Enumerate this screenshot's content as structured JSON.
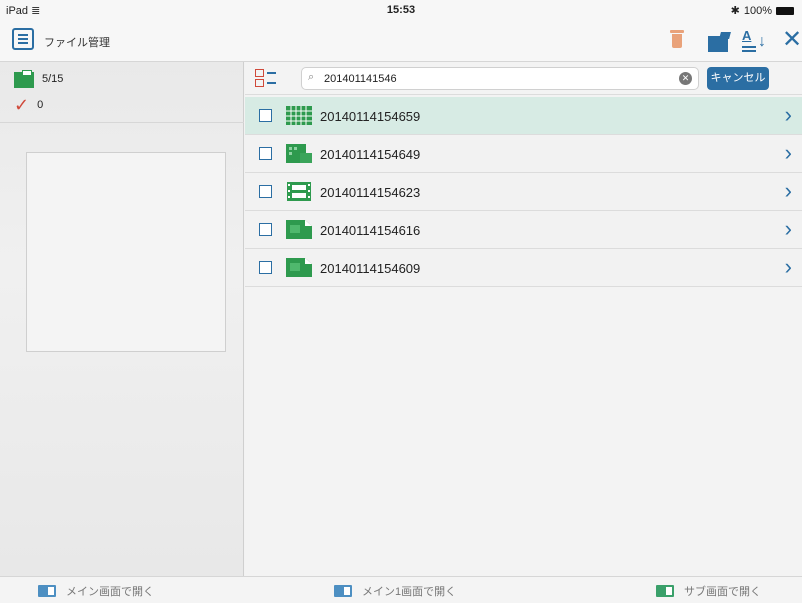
{
  "status": {
    "device": "iPad",
    "time": "15:53",
    "battery": "100%"
  },
  "nav": {
    "title": "ファイル管理"
  },
  "sidebar": {
    "count": "5/15",
    "checked_count": "0"
  },
  "search": {
    "query": "201401141546",
    "cancel_label": "キャンセル"
  },
  "files": [
    {
      "name": "20140114154659",
      "type": "grid-image",
      "selected": true
    },
    {
      "name": "20140114154649",
      "type": "jpg-image",
      "selected": false
    },
    {
      "name": "20140114154623",
      "type": "film",
      "selected": false
    },
    {
      "name": "20140114154616",
      "type": "document",
      "selected": false
    },
    {
      "name": "20140114154609",
      "type": "document",
      "selected": false
    }
  ],
  "bottom": {
    "open_main": "メイン画面で開く",
    "open_main1": "メイン1画面で開く",
    "open_sub": "サブ画面で開く"
  },
  "colors": {
    "accent": "#2b6ea3",
    "file_green": "#2e9a4e",
    "selected_row": "#d7ebe4",
    "check_red": "#d0493a"
  }
}
